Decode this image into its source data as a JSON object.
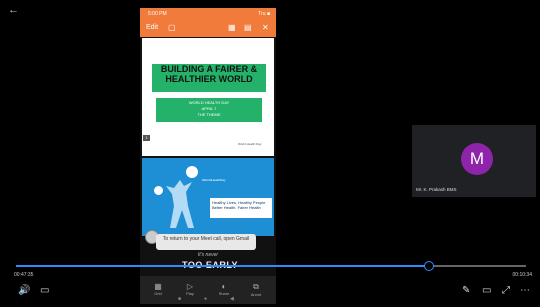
{
  "player": {
    "back_glyph": "←",
    "elapsed": "00:47:35",
    "remaining": "00:10:34",
    "progress": 0.81,
    "controls": {
      "volume_icon": "🔊",
      "captions_icon": "▭",
      "pen_icon": "✎",
      "theater_icon": "▭",
      "fullscreen_icon": "⤢",
      "more_icon": "⋯"
    }
  },
  "phone": {
    "status_time": "5:00 PM",
    "status_right": "Tru ■",
    "toolbar_edit": "Edit",
    "toolbar_icons": [
      "▢",
      "▦",
      "▤",
      "✕"
    ],
    "slide1": {
      "title": "BUILDING A FAIRER & HEALTHIER WORLD",
      "sub_lines": [
        "WORLD HEALTH DAY",
        "APRIL 7",
        "THE THEME"
      ],
      "slide_number": "1",
      "footer": "World Health Day"
    },
    "slide2": {
      "heading": "#WorldHealthDay",
      "text": "Healthy Lives, Healthy People Better Health. Fairer Health"
    },
    "toast": "To return to your Meet call, open Gmail",
    "tagline": "It's never",
    "big_text": "TOO EARLY",
    "bottom_buttons": [
      {
        "icon": "▦",
        "label": "Grid"
      },
      {
        "icon": "▷",
        "label": "Play"
      },
      {
        "icon": "◐",
        "label": "Share"
      },
      {
        "icon": "⧉",
        "label": "Annot"
      }
    ],
    "nav": [
      "■",
      "●",
      "◀"
    ]
  },
  "participant": {
    "initial": "M",
    "name": "Mr. K. Prakash BMS",
    "avatar_color": "#8e24aa"
  },
  "colors": {
    "accent": "#2e8bff",
    "phone_header": "#f07b3a",
    "slide_green": "#24b26a",
    "slide_blue": "#1e8fd4"
  }
}
